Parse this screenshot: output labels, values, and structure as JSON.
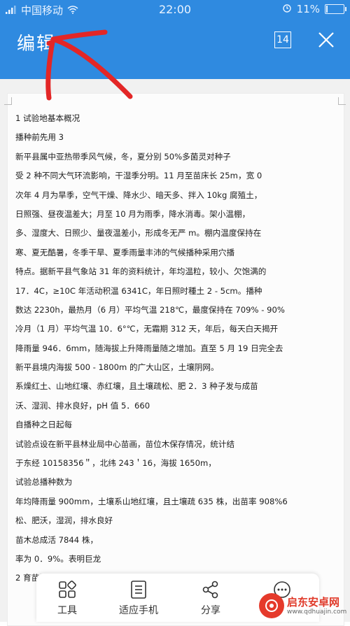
{
  "status_bar": {
    "carrier": "中国移动",
    "time": "22:00",
    "battery_text": "11%",
    "battery_level": 0.11
  },
  "header": {
    "title": "编辑",
    "page_count": "14",
    "accent_color": "#2f8ae0"
  },
  "document": {
    "lines": [
      "1 试验地基本概况",
      "播种前先用 3",
      "新平县属中亚热带季风气候，冬，夏分别 50%多菌灵对种子",
      "受 2 种不同大气环流影响，干湿季分明。11 月至苗床长 25m，宽 0",
      "次年 4 月为旱季，空气干燥、降水少、暗天多、拌入 10kg 腐殖土，",
      "日照强、昼夜温差大；月至 10 月为雨季，降水消毒。架小温棚，",
      "多、湿度大、日照少、量夜温差小，形成冬无严 m。棚内温度保持在",
      "寒、夏无酷暑，冬季干旱、夏季雨量丰沛的气候播种采用穴播",
      "特点。据新平县气象站 31 年的资料统计，年均温粒，较小、欠饱满的",
      "17．4C，≥10C 年活动积温 6341C，年日照时種土 2 - 5cm。播种",
      "数达 2230h，最热月（6 月）平均气温 218℃，最度保持在 709% - 90%",
      "冷月（1 月）平均气温 10．6°℃，无霜期 312 天，年后，每天白天揭开",
      "降雨量 946．6mm，随海拔上升降雨量随之增加。直至 5 月 19 日完全去",
      "新平县境内海拔 500 - 1800m 的广大山区，土壤阴网。",
      "系燥红土、山地红壤、赤红壤，且土壤疏松、肥 2．3 种子发与成苗",
      "沃、湿润、排水良好，pH 值 5．660",
      "自播种之日起每",
      "试验点设在新平县林业局中心苗画，苗位木保存情况，统计结",
      "于东经 10158356＂，北纬 243＇16，海拔 1650m，",
      "试验总播种数为",
      "年均降雨量 900mm，土壤系山地红壤，且土壤疏 635 株，出苗率 908%6",
      "松、肥沃，湿润，排水良好",
      "苗木总成活 7844 株，",
      "率为 0．9%。表明巨龙",
      "2 育苗试验"
    ]
  },
  "toolbar": {
    "tools_label": "工具",
    "fit_phone_label": "适应手机",
    "share_label": "分享"
  },
  "watermark": {
    "name": "启东安卓网",
    "url": "www.qdhuajin.com"
  },
  "annotation_color": "#e32626"
}
